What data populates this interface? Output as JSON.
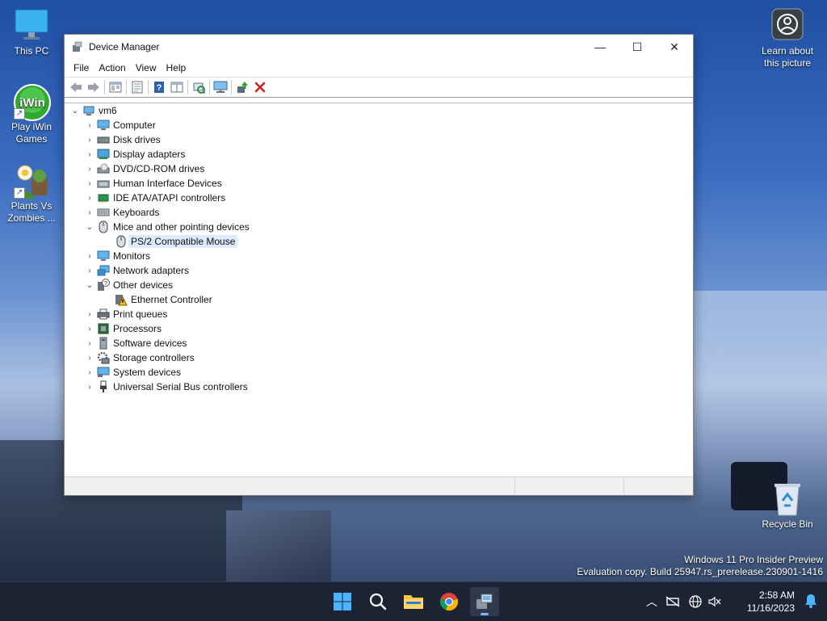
{
  "desktop": {
    "icons": [
      {
        "label": "This PC"
      },
      {
        "label": "Play iWin Games"
      },
      {
        "label": "Plants Vs Zombies ..."
      },
      {
        "label": "Learn about this picture"
      },
      {
        "label": "Recycle Bin"
      }
    ],
    "watermark": {
      "line1": "Windows 11 Pro Insider Preview",
      "line2": "Evaluation copy. Build 25947.rs_prerelease.230901-1416"
    }
  },
  "window": {
    "title": "Device Manager",
    "controls": {
      "minimize": "—",
      "maximize": "☐",
      "close": "✕"
    },
    "menu": [
      "File",
      "Action",
      "View",
      "Help"
    ],
    "toolbar": [
      "back-icon",
      "forward-icon",
      "properties-view-icon",
      "list-view-icon",
      "help-icon",
      "resources-icon",
      "scan-hardware-icon",
      "monitor-icon",
      "update-driver-icon",
      "uninstall-icon"
    ],
    "tree": {
      "root": "vm6",
      "categories": [
        {
          "label": "Computer",
          "expanded": false
        },
        {
          "label": "Disk drives",
          "expanded": false
        },
        {
          "label": "Display adapters",
          "expanded": false
        },
        {
          "label": "DVD/CD-ROM drives",
          "expanded": false
        },
        {
          "label": "Human Interface Devices",
          "expanded": false
        },
        {
          "label": "IDE ATA/ATAPI controllers",
          "expanded": false
        },
        {
          "label": "Keyboards",
          "expanded": false
        },
        {
          "label": "Mice and other pointing devices",
          "expanded": true,
          "children": [
            "PS/2 Compatible Mouse"
          ]
        },
        {
          "label": "Monitors",
          "expanded": false
        },
        {
          "label": "Network adapters",
          "expanded": false
        },
        {
          "label": "Other devices",
          "expanded": true,
          "children": [
            "Ethernet Controller"
          ]
        },
        {
          "label": "Print queues",
          "expanded": false
        },
        {
          "label": "Processors",
          "expanded": false
        },
        {
          "label": "Software devices",
          "expanded": false
        },
        {
          "label": "Storage controllers",
          "expanded": false
        },
        {
          "label": "System devices",
          "expanded": false
        },
        {
          "label": "Universal Serial Bus controllers",
          "expanded": false
        }
      ],
      "selected": "PS/2 Compatible Mouse"
    }
  },
  "taskbar": {
    "apps": [
      "start-icon",
      "search-icon",
      "file-explorer-icon",
      "chrome-icon",
      "device-manager-icon"
    ],
    "clock": {
      "time": "2:58 AM",
      "date": "11/16/2023"
    }
  },
  "colors": {
    "selection": "#dcebfc",
    "accent": "#0067c0",
    "taskbar": "#1c2433"
  }
}
